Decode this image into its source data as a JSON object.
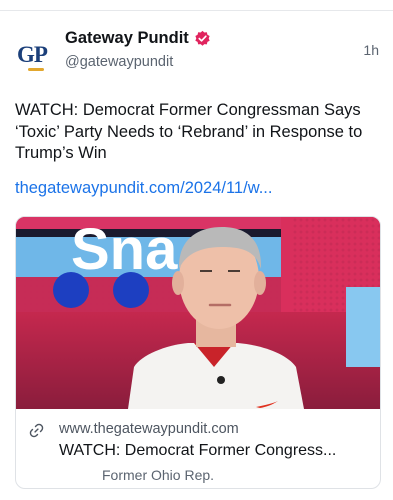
{
  "post": {
    "author": {
      "initials": "GP",
      "name": "Gateway Pundit",
      "handle": "@gatewaypundit",
      "verified_badge_icon": "verified-badge-icon"
    },
    "time": "1h",
    "text": "WATCH: Democrat Former Congressman Says ‘Toxic’ Party Needs to ‘Rebrand’ in Response to Trump’s Win",
    "link": "thegatewaypundit.com/2024/11/w...",
    "card": {
      "image_background_text": "Sna",
      "domain": "www.thegatewaypundit.com",
      "title": "WATCH: Democrat Former Congress...",
      "description": "Former Ohio Rep.",
      "link_icon": "link-icon"
    }
  },
  "colors": {
    "link": "#1b73e8",
    "verified": "#e0245e",
    "brand_blue": "#1b3f7a",
    "brand_gold": "#e2a72e"
  }
}
